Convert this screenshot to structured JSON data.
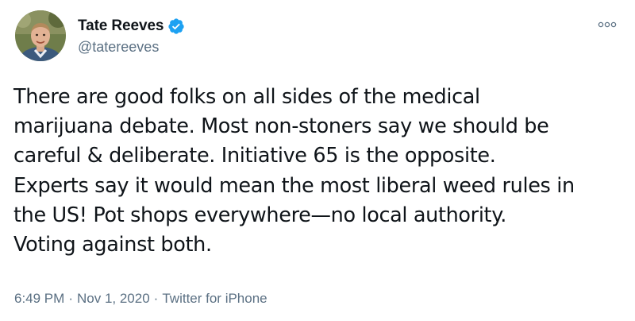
{
  "author": {
    "display_name": "Tate Reeves",
    "handle": "@tatereeves",
    "verified": true
  },
  "icons": {
    "verified": "verified-badge-icon",
    "more": "more-dots-icon",
    "avatar": "profile-photo"
  },
  "tweet": {
    "lines": [
      "There are good folks on all sides of the medical",
      "marijuana debate. Most non-stoners say we should be",
      "careful & deliberate. Initiative 65 is the opposite.",
      "Experts say it would mean the most liberal weed rules in",
      "the US! Pot shops everywhere—no local authority.",
      "Voting against both."
    ]
  },
  "meta": {
    "time": "6:49 PM",
    "separator": "·",
    "date": "Nov 1, 2020",
    "source": "Twitter for iPhone"
  },
  "colors": {
    "text": "#0f1419",
    "secondary": "#5b7083",
    "verified_blue": "#1da1f2",
    "background": "#ffffff"
  }
}
